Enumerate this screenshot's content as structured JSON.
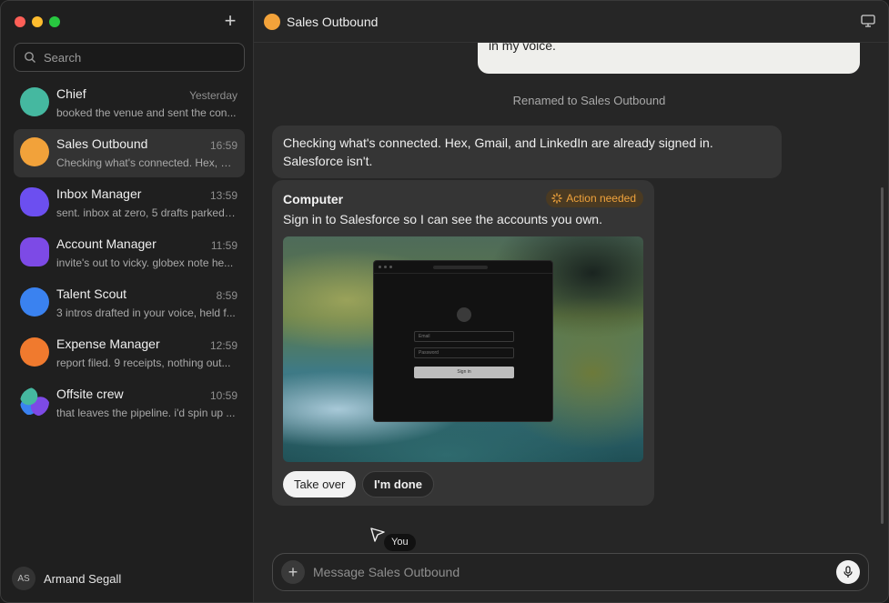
{
  "sidebar": {
    "search_placeholder": "Search",
    "chats": [
      {
        "name": "Chief",
        "time": "Yesterday",
        "preview": "booked the venue and sent the con...",
        "color": "#45b8a0",
        "icon": "chief-avatar-icon"
      },
      {
        "name": "Sales Outbound",
        "time": "16:59",
        "preview": "Checking what's connected. Hex, G...",
        "color": "#f2a23a",
        "icon": "sales-outbound-avatar-icon"
      },
      {
        "name": "Inbox Manager",
        "time": "13:59",
        "preview": "sent. inbox at zero, 5 drafts parked ...",
        "color": "#6c4ff0",
        "icon": "inbox-manager-avatar-icon"
      },
      {
        "name": "Account Manager",
        "time": "11:59",
        "preview": "invite's out to vicky. globex note he...",
        "color": "#7d4ae6",
        "icon": "account-manager-avatar-icon"
      },
      {
        "name": "Talent Scout",
        "time": "8:59",
        "preview": "3 intros drafted in your voice, held f...",
        "color": "#3a82f0",
        "icon": "talent-scout-avatar-icon"
      },
      {
        "name": "Expense Manager",
        "time": "12:59",
        "preview": "report filed. 9 receipts, nothing out...",
        "color": "#f07a2e",
        "icon": "expense-manager-avatar-icon"
      },
      {
        "name": "Offsite crew",
        "time": "10:59",
        "preview": "that leaves the pipeline. i'd spin up ...",
        "color": "#7d4ae6",
        "icon": "offsite-crew-avatar-icon"
      }
    ],
    "user": {
      "initials": "AS",
      "name": "Armand Segall"
    }
  },
  "header": {
    "title": "Sales Outbound"
  },
  "messages": {
    "user_message": "Gamble, and Salesforce. Draft email and LinkedIn sequences in my voice.",
    "system": "Renamed to Sales Outbound",
    "assistant": "Checking what's connected. Hex, Gmail, and LinkedIn are already signed in. Salesforce isn't."
  },
  "card": {
    "title": "Computer",
    "badge": "Action needed",
    "description": "Sign in to Salesforce so I can see the accounts you own.",
    "mock": {
      "email": "Email",
      "password": "Password",
      "signin": "Sign in"
    },
    "take_over": "Take over",
    "done": "I'm done"
  },
  "cursor_label": "You",
  "composer": {
    "placeholder": "Message Sales Outbound"
  }
}
